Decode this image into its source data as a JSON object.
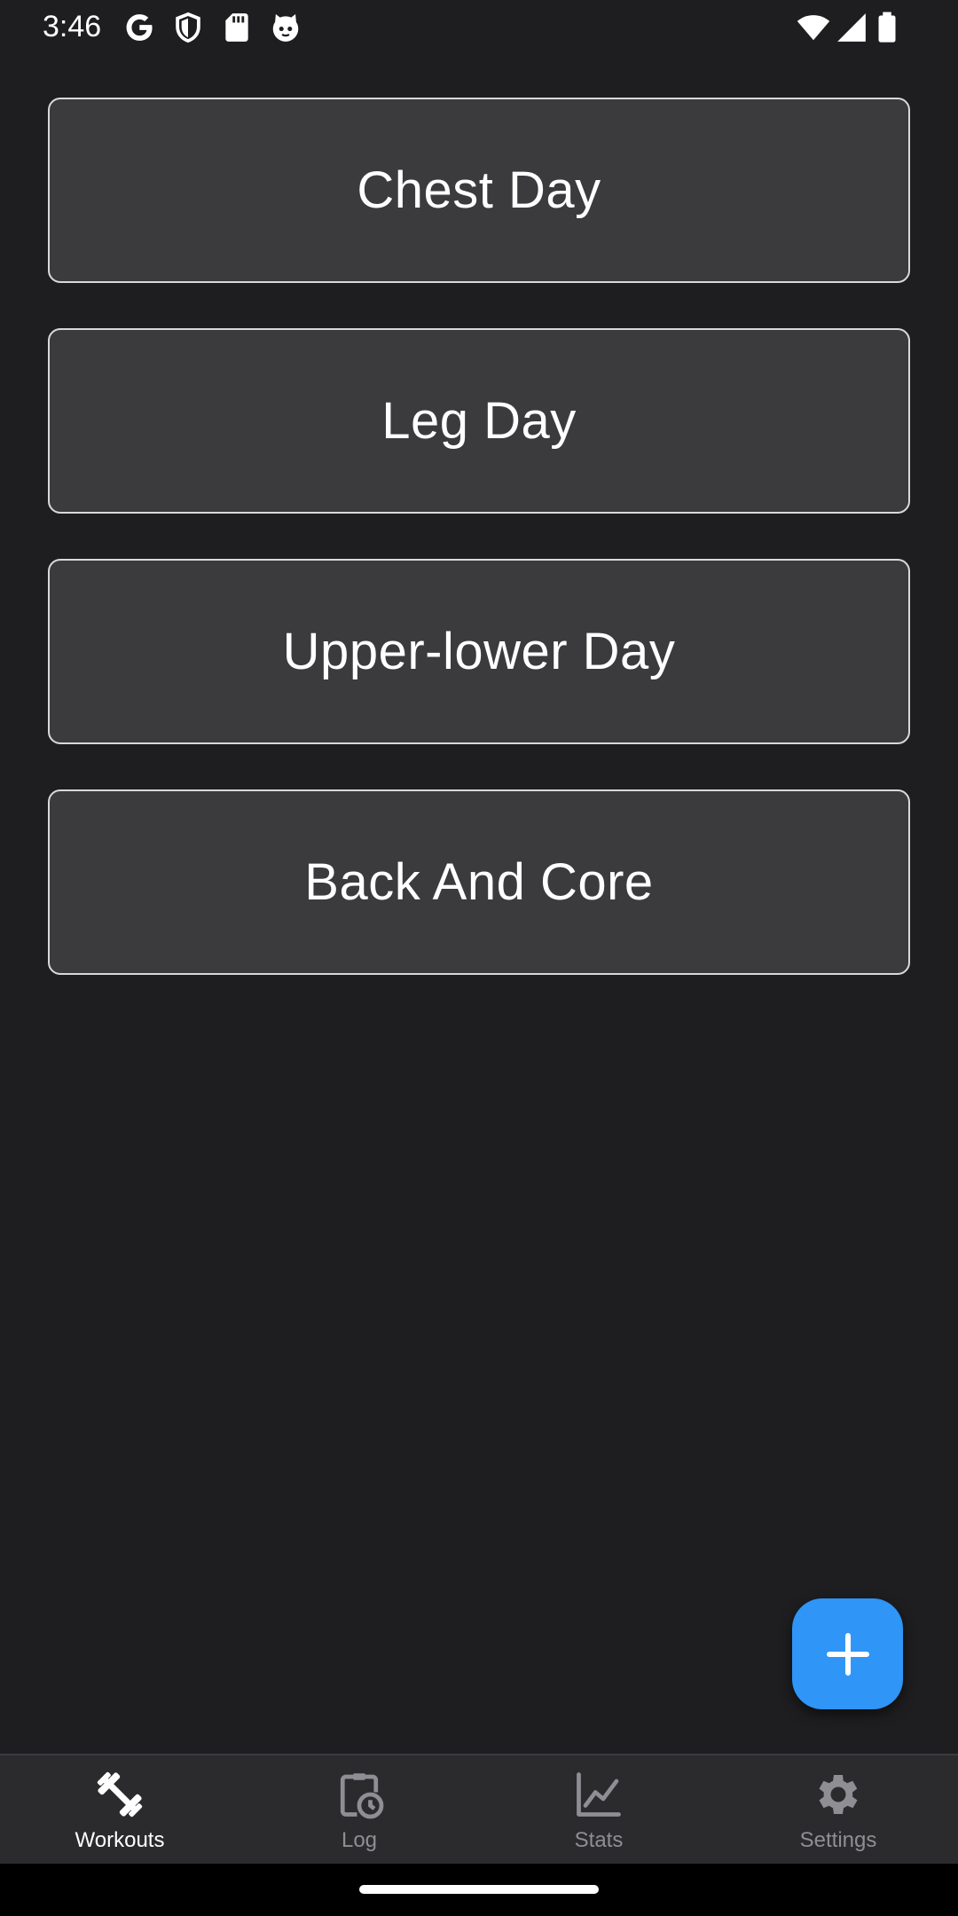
{
  "status_bar": {
    "time": "3:46",
    "left_icons": [
      "google-icon",
      "shield-icon",
      "sd-card-icon",
      "cat-face-icon"
    ],
    "right_icons": [
      "wifi-icon",
      "cell-signal-icon",
      "battery-icon"
    ]
  },
  "workouts": [
    {
      "label": "Chest Day"
    },
    {
      "label": "Leg Day"
    },
    {
      "label": "Upper-lower Day"
    },
    {
      "label": "Back And Core"
    }
  ],
  "fab": {
    "icon": "plus-icon",
    "color": "#2f95f7"
  },
  "bottom_nav": {
    "items": [
      {
        "label": "Workouts",
        "icon": "dumbbell-icon",
        "active": true
      },
      {
        "label": "Log",
        "icon": "clipboard-clock-icon",
        "active": false
      },
      {
        "label": "Stats",
        "icon": "line-chart-icon",
        "active": false
      },
      {
        "label": "Settings",
        "icon": "gear-icon",
        "active": false
      }
    ]
  },
  "colors": {
    "background": "#1e1e20",
    "card": "#3b3b3e",
    "card_border": "#d9d9dc",
    "accent": "#2f95f7",
    "nav_background": "#2b2b2e",
    "nav_inactive": "#8e8e93",
    "nav_active": "#ffffff"
  }
}
